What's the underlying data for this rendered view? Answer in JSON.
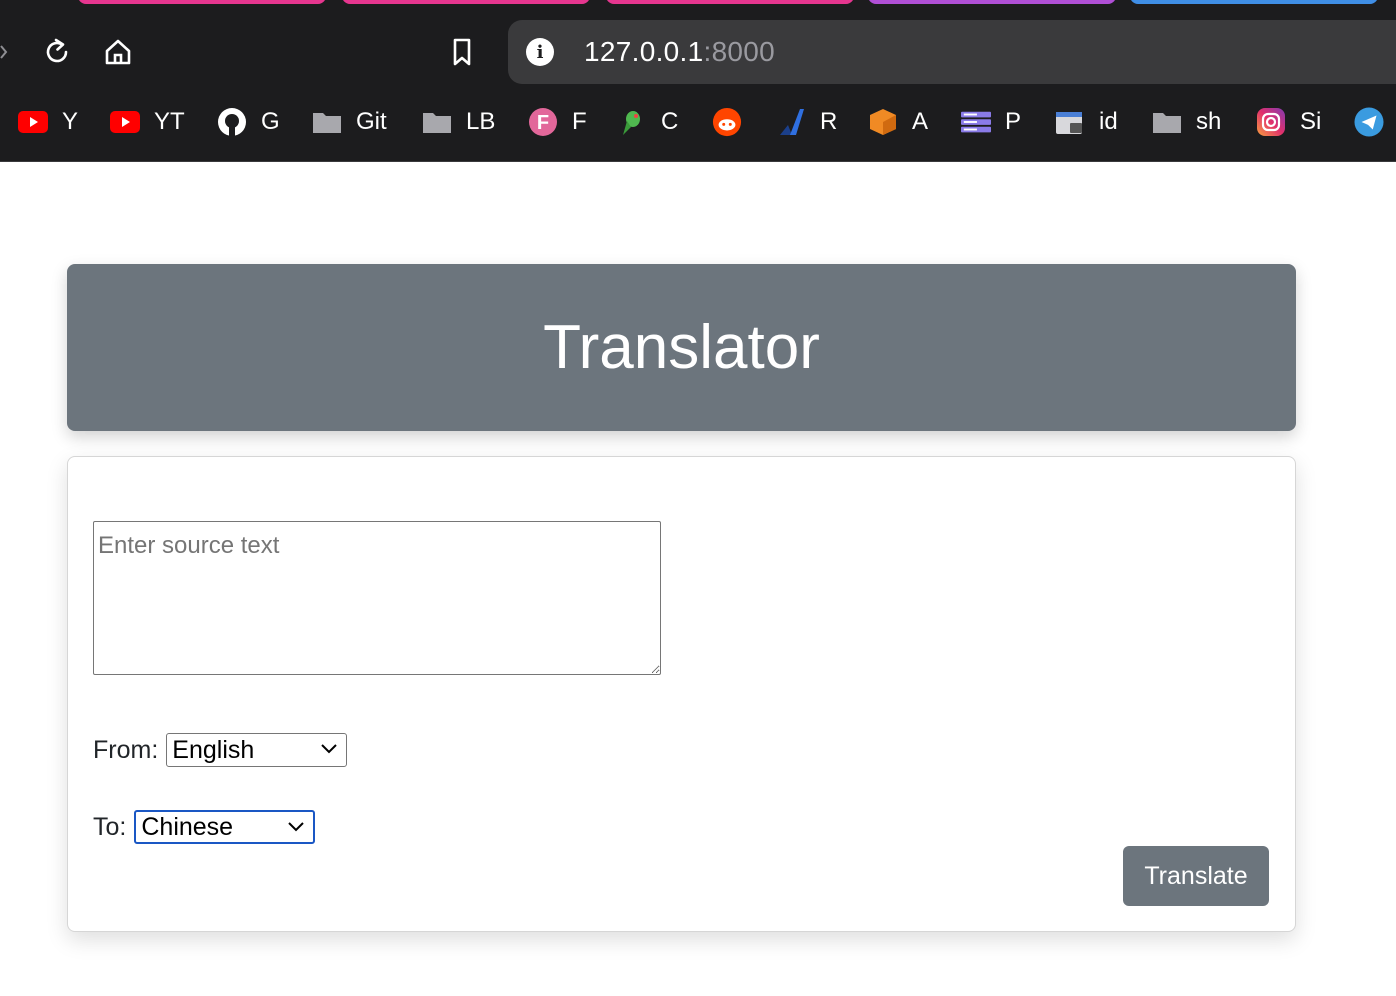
{
  "browser": {
    "url_host": "127.0.0.1",
    "url_port": ":8000",
    "bookmarks": [
      {
        "icon": "youtube-icon",
        "label": "Y"
      },
      {
        "icon": "youtube-icon",
        "label": "YT"
      },
      {
        "icon": "github-icon",
        "label": "G"
      },
      {
        "icon": "folder-icon",
        "label": "Git"
      },
      {
        "icon": "folder-icon",
        "label": "LB"
      },
      {
        "icon": "f-circle-icon",
        "label": "F"
      },
      {
        "icon": "parrot-icon",
        "label": "C"
      },
      {
        "icon": "reddit-icon",
        "label": ""
      },
      {
        "icon": "blue-stripe-icon",
        "label": "R"
      },
      {
        "icon": "orange-box-icon",
        "label": "A"
      },
      {
        "icon": "server-icon",
        "label": "P"
      },
      {
        "icon": "window-lock-icon",
        "label": "id"
      },
      {
        "icon": "folder-icon",
        "label": "sh"
      },
      {
        "icon": "instagram-icon",
        "label": "Si"
      },
      {
        "icon": "telegram-icon",
        "label": ""
      }
    ]
  },
  "page": {
    "title": "Translator",
    "source_placeholder": "Enter source text",
    "from_label": "From:",
    "from_value": "English",
    "to_label": "To:",
    "to_value": "Chinese",
    "translate_button": "Translate"
  },
  "colors": {
    "header_bg": "#6c757d",
    "button_bg": "#6c757d",
    "focus_ring": "#1a57c4"
  }
}
